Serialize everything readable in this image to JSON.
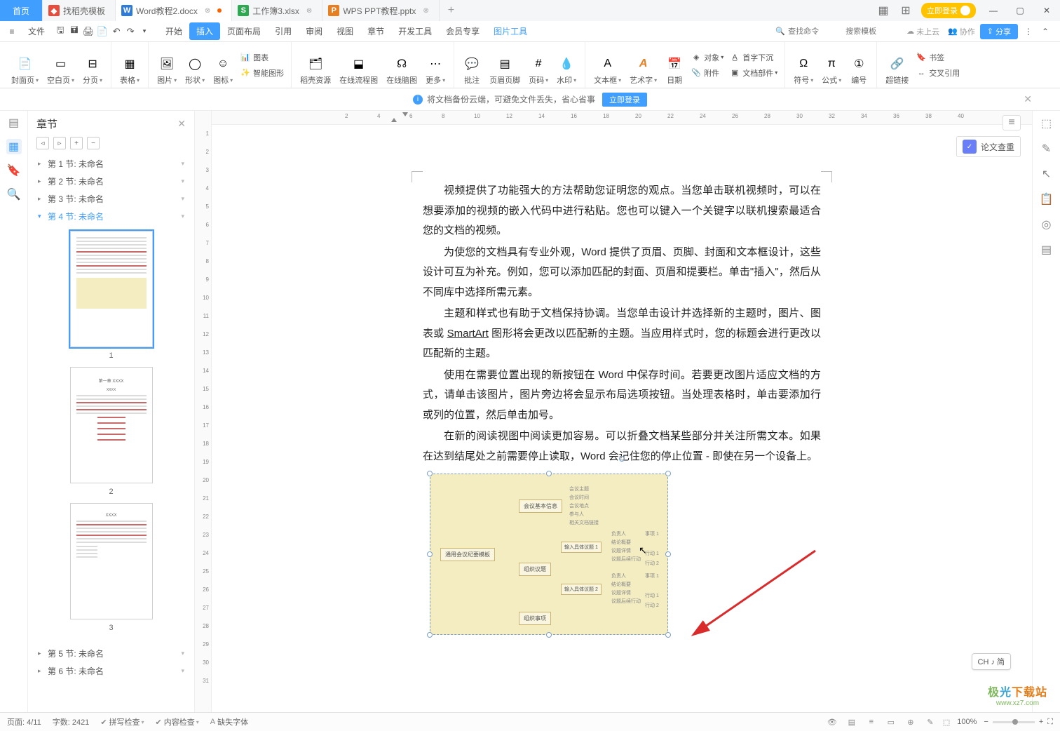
{
  "titlebar": {
    "home": "首页",
    "tabs": [
      {
        "label": "找稻壳模板",
        "icon_color": "#e74c3c",
        "icon_text": "D"
      },
      {
        "label": "Word教程2.docx",
        "icon_color": "#2f7bd8",
        "icon_text": "W",
        "active": true,
        "modified": true
      },
      {
        "label": "工作簿3.xlsx",
        "icon_color": "#2ea851",
        "icon_text": "S"
      },
      {
        "label": "WPS PPT教程.pptx",
        "icon_color": "#e67e22",
        "icon_text": "P"
      }
    ],
    "login": "立即登录"
  },
  "menubar": {
    "file": "文件",
    "tabs": [
      "开始",
      "插入",
      "页面布局",
      "引用",
      "审阅",
      "视图",
      "章节",
      "开发工具",
      "会员专享"
    ],
    "active_index": 1,
    "context_tab": "图片工具",
    "search_placeholder_cmd": "查找命令",
    "search_placeholder_tpl": "搜索模板",
    "cloud_unsync": "未上云",
    "collab": "协作",
    "share": "分享"
  },
  "ribbon": {
    "cover_page": "封面页",
    "blank_page": "空白页",
    "page_break": "分页",
    "table": "表格",
    "picture": "图片",
    "shape": "形状",
    "icon": "图标",
    "smart_shape": "智能图形",
    "chart": "图表",
    "daoke_res": "稻壳资源",
    "flowchart": "在线流程图",
    "mindmap": "在线脑图",
    "more": "更多",
    "comment": "批注",
    "header_footer": "页眉页脚",
    "page_num": "页码",
    "watermark": "水印",
    "text_box": "文本框",
    "wordart": "艺术字",
    "date": "日期",
    "object": "对象",
    "first_drop": "首字下沉",
    "attachment": "附件",
    "doc_parts": "文档部件",
    "symbol": "符号",
    "equation": "公式",
    "number": "编号",
    "hyperlink": "超链接",
    "bookmark": "书签",
    "crossref": "交叉引用"
  },
  "banner": {
    "text": "将文档备份云端，可避免文件丢失，省心省事",
    "btn": "立即登录"
  },
  "chapter_panel": {
    "title": "章节",
    "items": [
      {
        "label": "第 1 节: 未命名"
      },
      {
        "label": "第 2 节: 未命名"
      },
      {
        "label": "第 3 节: 未命名"
      },
      {
        "label": "第 4 节: 未命名",
        "expanded": true
      },
      {
        "label": "第 5 节: 未命名"
      },
      {
        "label": "第 6 节: 未命名"
      }
    ],
    "thumb_nums": [
      "1",
      "2",
      "3"
    ],
    "thumb2_title": "第一章 XXXX",
    "thumb3_title": "XXXX"
  },
  "hruler_marks": [
    "2",
    "4",
    "6",
    "8",
    "10",
    "12",
    "14",
    "16",
    "18",
    "20",
    "22",
    "24",
    "26",
    "28",
    "30",
    "32",
    "34",
    "36",
    "38",
    "40"
  ],
  "vruler_marks": [
    "1",
    "2",
    "3",
    "4",
    "5",
    "6",
    "7",
    "8",
    "9",
    "10",
    "11",
    "12",
    "13",
    "14",
    "15",
    "16",
    "17",
    "18",
    "19",
    "20",
    "21",
    "22",
    "23",
    "24",
    "25",
    "26",
    "27",
    "28",
    "29",
    "30",
    "31"
  ],
  "document": {
    "p1": "视频提供了功能强大的方法帮助您证明您的观点。当您单击联机视频时，可以在想要添加的视频的嵌入代码中进行粘贴。您也可以键入一个关键字以联机搜索最适合您的文档的视频。",
    "p2a": "为使您的文档具有专业外观，Word 提供了页眉、页脚、封面和文本框设计，这些设计可互为补充。例如，您可以添加匹配的封面、页眉和提要栏。单击\"插入\"，然后从不同库中选择所需元素。",
    "p3a": "主题和样式也有助于文档保持协调。当您单击设计并选择新的主题时，图片、图表或 ",
    "p3_link": "SmartArt",
    "p3b": " 图形将会更改以匹配新的主题。当应用样式时，您的标题会进行更改以匹配新的主题。",
    "p4": "使用在需要位置出现的新按钮在 Word 中保存时间。若要更改图片适应文档的方式，请单击该图片，图片旁边将会显示布局选项按钮。当处理表格时，单击要添加行或列的位置，然后单击加号。",
    "p5": "在新的阅读视图中阅读更加容易。可以折叠文档某些部分并关注所需文本。如果在达到结尾处之前需要停止读取，Word 会记住您的停止位置 - 即使在另一个设备上。"
  },
  "mindmap": {
    "root": "通用会议纪要模板",
    "n1": "会议基本信息",
    "n2": "组织议题",
    "n3": "组织事项",
    "n1_leaves": [
      "会议主题",
      "会议时间",
      "会议地点",
      "参与人",
      "相关文档链接"
    ],
    "sub1": "输入具体议题 1",
    "sub2": "输入具体议题 2",
    "leaves2": [
      "负责人",
      "结论概要",
      "议题详情",
      "议题后续行动"
    ],
    "tags": [
      "事项 1",
      "行动 1",
      "行动 2",
      "事项 1",
      "行动 1",
      "行动 2"
    ]
  },
  "rfloat": {
    "paper_check": "论文查重"
  },
  "statusbar": {
    "page": "页面: 4/11",
    "words": "字数: 2421",
    "spell": "拼写检查",
    "content": "内容检查",
    "missing_font": "缺失字体",
    "zoom": "100%"
  },
  "ime": "CH ♪ 简",
  "watermark": {
    "l1": "极光下载站",
    "l2": "www.xz7.com"
  }
}
